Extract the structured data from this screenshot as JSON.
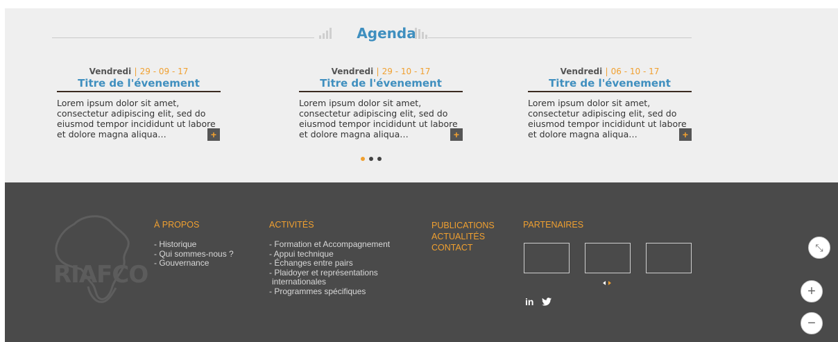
{
  "agenda": {
    "title": "Agenda",
    "events": [
      {
        "day": "Vendredi",
        "sep": "|",
        "date": "29 - 09 - 17",
        "title": "Titre de l'évenement",
        "text": "Lorem ipsum dolor sit amet, consectetur adipiscing elit, sed do eiusmod tempor incididunt ut labore et dolore magna aliqua…",
        "more": "+"
      },
      {
        "day": "Vendredi",
        "sep": "|",
        "date": "29 - 10 - 17",
        "title": "Titre de l'évenement",
        "text": "Lorem ipsum dolor sit amet, consectetur adipiscing elit, sed do eiusmod tempor incididunt ut labore et dolore magna aliqua…",
        "more": "+"
      },
      {
        "day": "Vendredi",
        "sep": "|",
        "date": "06 - 10 - 17",
        "title": "Titre de l'évenement",
        "text": "Lorem ipsum dolor sit amet, consectetur adipiscing elit, sed do eiusmod tempor incididunt ut labore et dolore magna aliqua…",
        "more": "+"
      }
    ],
    "pagination": {
      "count": 3,
      "active": 1
    }
  },
  "footer": {
    "logo_text": "RIAFCO",
    "apropos": {
      "heading": "À PROPOS",
      "items": [
        "- Historique",
        "- Qui sommes-nous ?",
        "- Gouvernance"
      ]
    },
    "activites": {
      "heading": "ACTIVITÉS",
      "items": [
        "- Formation et Accompagnement",
        "- Appui technique",
        "- Échanges entre pairs",
        "- Plaidoyer et représentations",
        "  internationales",
        "- Programmes spécifiques"
      ]
    },
    "links": [
      "PUBLICATIONS",
      "ACTUALITÉS",
      "CONTACT"
    ],
    "partenaires": {
      "heading": "PARTENAIRES"
    },
    "social": {
      "linkedin": "in",
      "twitter_icon": "twitter-icon"
    }
  },
  "controls": {
    "fullscreen": "⤡",
    "zoom_in": "+",
    "zoom_out": "−"
  },
  "colors": {
    "accent": "#f0a030",
    "blue": "#3f8fbf",
    "footer_bg": "#4a4a4a",
    "agenda_bg": "#efefef"
  }
}
